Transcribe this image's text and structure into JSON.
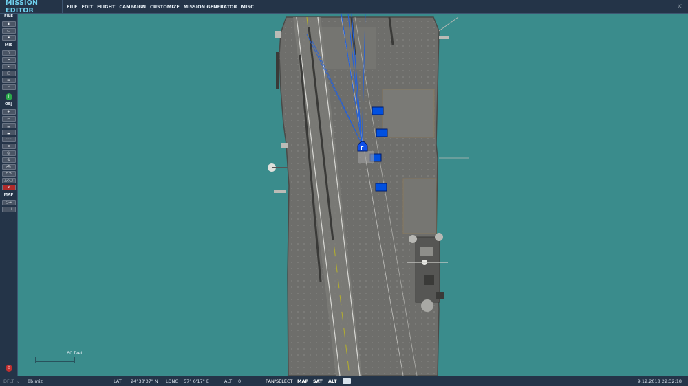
{
  "window": {
    "title": "MISSION EDITOR",
    "close_glyph": "×"
  },
  "menu": [
    "FILE",
    "EDIT",
    "FLIGHT",
    "CAMPAIGN",
    "CUSTOMIZE",
    "MISSION GENERATOR",
    "MISC"
  ],
  "toolbar": {
    "file_label": "FILE",
    "mis_label": "MIS",
    "obj_label": "OBJ",
    "map_label": "MAP",
    "file_buttons": [
      {
        "icon": "new-file-icon",
        "glyph": "▮"
      },
      {
        "icon": "open-folder-icon",
        "glyph": "▭"
      },
      {
        "icon": "save-disk-icon",
        "glyph": "▪"
      }
    ],
    "mis_buttons": [
      {
        "icon": "briefing-icon",
        "glyph": "▯"
      },
      {
        "icon": "weather-cloud-icon",
        "glyph": "☁"
      },
      {
        "icon": "triggers-icon",
        "glyph": "⌁"
      },
      {
        "icon": "goals-icon",
        "glyph": "□"
      },
      {
        "icon": "options-icon",
        "glyph": "▬"
      },
      {
        "icon": "check-icon",
        "glyph": "✓"
      }
    ],
    "green_button": {
      "icon": "green-circle-icon",
      "glyph": "↑",
      "color": "#2aa84a"
    },
    "obj_buttons": [
      {
        "icon": "plane-icon",
        "glyph": "✈"
      },
      {
        "icon": "helicopter-icon",
        "glyph": "⌐"
      },
      {
        "icon": "ship-icon",
        "glyph": "▁"
      },
      {
        "icon": "vehicle-icon",
        "glyph": "▃"
      },
      {
        "icon": "static-object-icon",
        "glyph": "◦◦◦"
      },
      {
        "icon": "waypoint-icon",
        "glyph": "-o-"
      },
      {
        "icon": "zone-icon",
        "glyph": "◎"
      },
      {
        "icon": "target-icon",
        "glyph": "⊙"
      },
      {
        "icon": "naval-icon",
        "glyph": "⛴"
      },
      {
        "icon": "template-icon",
        "glyph": "⊂⊃"
      },
      {
        "icon": "shapes-icon",
        "glyph": "△◇□"
      },
      {
        "icon": "delete-icon",
        "glyph": "✕"
      }
    ],
    "map_buttons": [
      {
        "icon": "key-icon",
        "glyph": "○⊸"
      },
      {
        "icon": "ruler-icon",
        "glyph": "⊢⊣"
      }
    ],
    "bottom_button": {
      "icon": "settings-red-icon",
      "glyph": "⚙",
      "color": "#c03030"
    }
  },
  "map": {
    "scale_label": "60 feet",
    "sea_color": "#3a8c8c",
    "deck_color": "#6e6e6b",
    "unit_color": "#0050e0"
  },
  "status": {
    "coalition": "DFLT",
    "coalition_caret": "⌄",
    "file": "8b.miz",
    "lat_label": "LAT",
    "lat_value": "24°38'37\" N",
    "long_label": "LONG",
    "long_value": "57° 6'17\" E",
    "alt_label": "ALT",
    "alt_value": "0",
    "buttons": [
      "PAN/SELECT",
      "MAP",
      "SAT",
      "ALT"
    ],
    "datetime": "9.12.2018 22:32:18"
  }
}
